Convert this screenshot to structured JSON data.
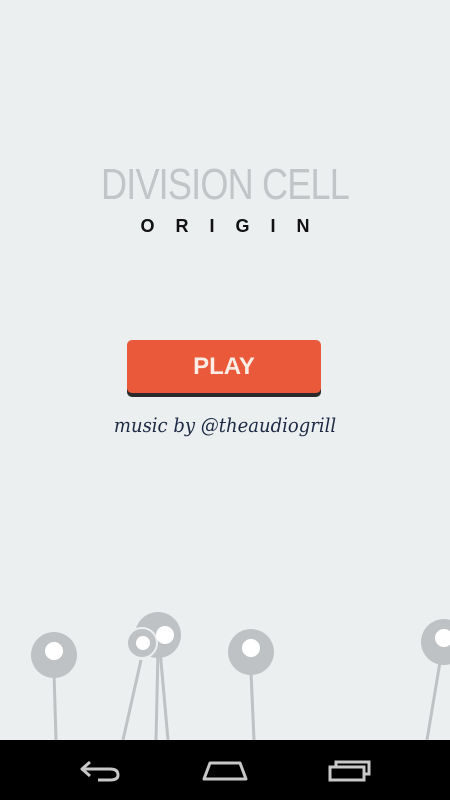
{
  "app": {
    "title": "DIVISION CELL",
    "subtitle": "ORIGIN"
  },
  "menu": {
    "play_label": "PLAY",
    "credit": "music by @theaudiogrill"
  },
  "colors": {
    "background": "#eceff0",
    "title": "#c2c5c7",
    "button": "#ea5a3a",
    "button_text": "#fbece6",
    "cell": "#bfc2c4",
    "navbar": "#000000"
  },
  "navbar": {
    "items": [
      {
        "icon": "back-icon"
      },
      {
        "icon": "home-icon"
      },
      {
        "icon": "recent-apps-icon"
      }
    ]
  }
}
